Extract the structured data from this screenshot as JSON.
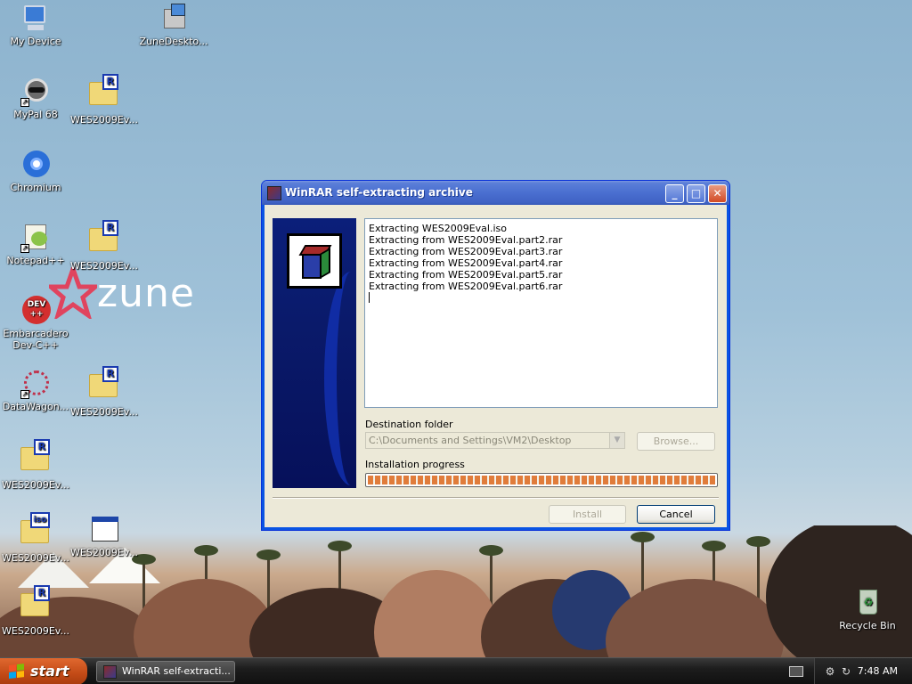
{
  "desktop": {
    "icons": [
      {
        "label": "My Device",
        "icon": "my-device-icon"
      },
      {
        "label": "ZuneDeskto...",
        "icon": "zune-installer-icon"
      },
      {
        "label": "MyPal 68",
        "icon": "mypal-icon"
      },
      {
        "label": "WES2009Ev...",
        "icon": "rar-archive-icon"
      },
      {
        "label": "Chromium",
        "icon": "chromium-icon"
      },
      {
        "label": "Notepad++",
        "icon": "notepadpp-icon"
      },
      {
        "label": "WES2009Ev...",
        "icon": "rar-archive-icon"
      },
      {
        "label": "Embarcadero Dev-C++",
        "icon": "devcpp-icon"
      },
      {
        "label": "DataWagon...",
        "icon": "datawagon-icon"
      },
      {
        "label": "WES2009Ev...",
        "icon": "rar-archive-icon"
      },
      {
        "label": "WES2009Ev...",
        "icon": "rar-archive-icon"
      },
      {
        "label": "WES2009Ev...",
        "icon": "iso-file-icon"
      },
      {
        "label": "WES2009Ev...",
        "icon": "window-file-icon"
      },
      {
        "label": "WES2009Ev...",
        "icon": "rar-archive-icon"
      },
      {
        "label": "Recycle Bin",
        "icon": "recycle-bin-icon"
      }
    ],
    "wallpaper_logo": "zune",
    "dev_badge": "DEV",
    "dev_badge_plus": "++",
    "rar_tag": "R",
    "iso_tag": "iso"
  },
  "window": {
    "title": "WinRAR self-extracting archive",
    "minimize_glyph": "_",
    "maximize_glyph": "□",
    "close_glyph": "✕",
    "log_lines": [
      "Extracting WES2009Eval.iso",
      "Extracting from WES2009Eval.part2.rar",
      "Extracting from WES2009Eval.part3.rar",
      "Extracting from WES2009Eval.part4.rar",
      "Extracting from WES2009Eval.part5.rar",
      "Extracting from WES2009Eval.part6.rar"
    ],
    "destination_label": "Destination folder",
    "destination_value": "C:\\Documents and Settings\\VM2\\Desktop",
    "dropdown_glyph": "▼",
    "browse_label": "Browse...",
    "progress_label": "Installation progress",
    "progress_fraction": 1.0,
    "install_label": "Install",
    "cancel_label": "Cancel"
  },
  "taskbar": {
    "start_label": "start",
    "task_label": "WinRAR self-extracti...",
    "clock": "7:48 AM"
  },
  "colors": {
    "titlebar": "#4a6fd0",
    "progress_fill": "#e07c3b",
    "start_button": "#c24a16"
  }
}
